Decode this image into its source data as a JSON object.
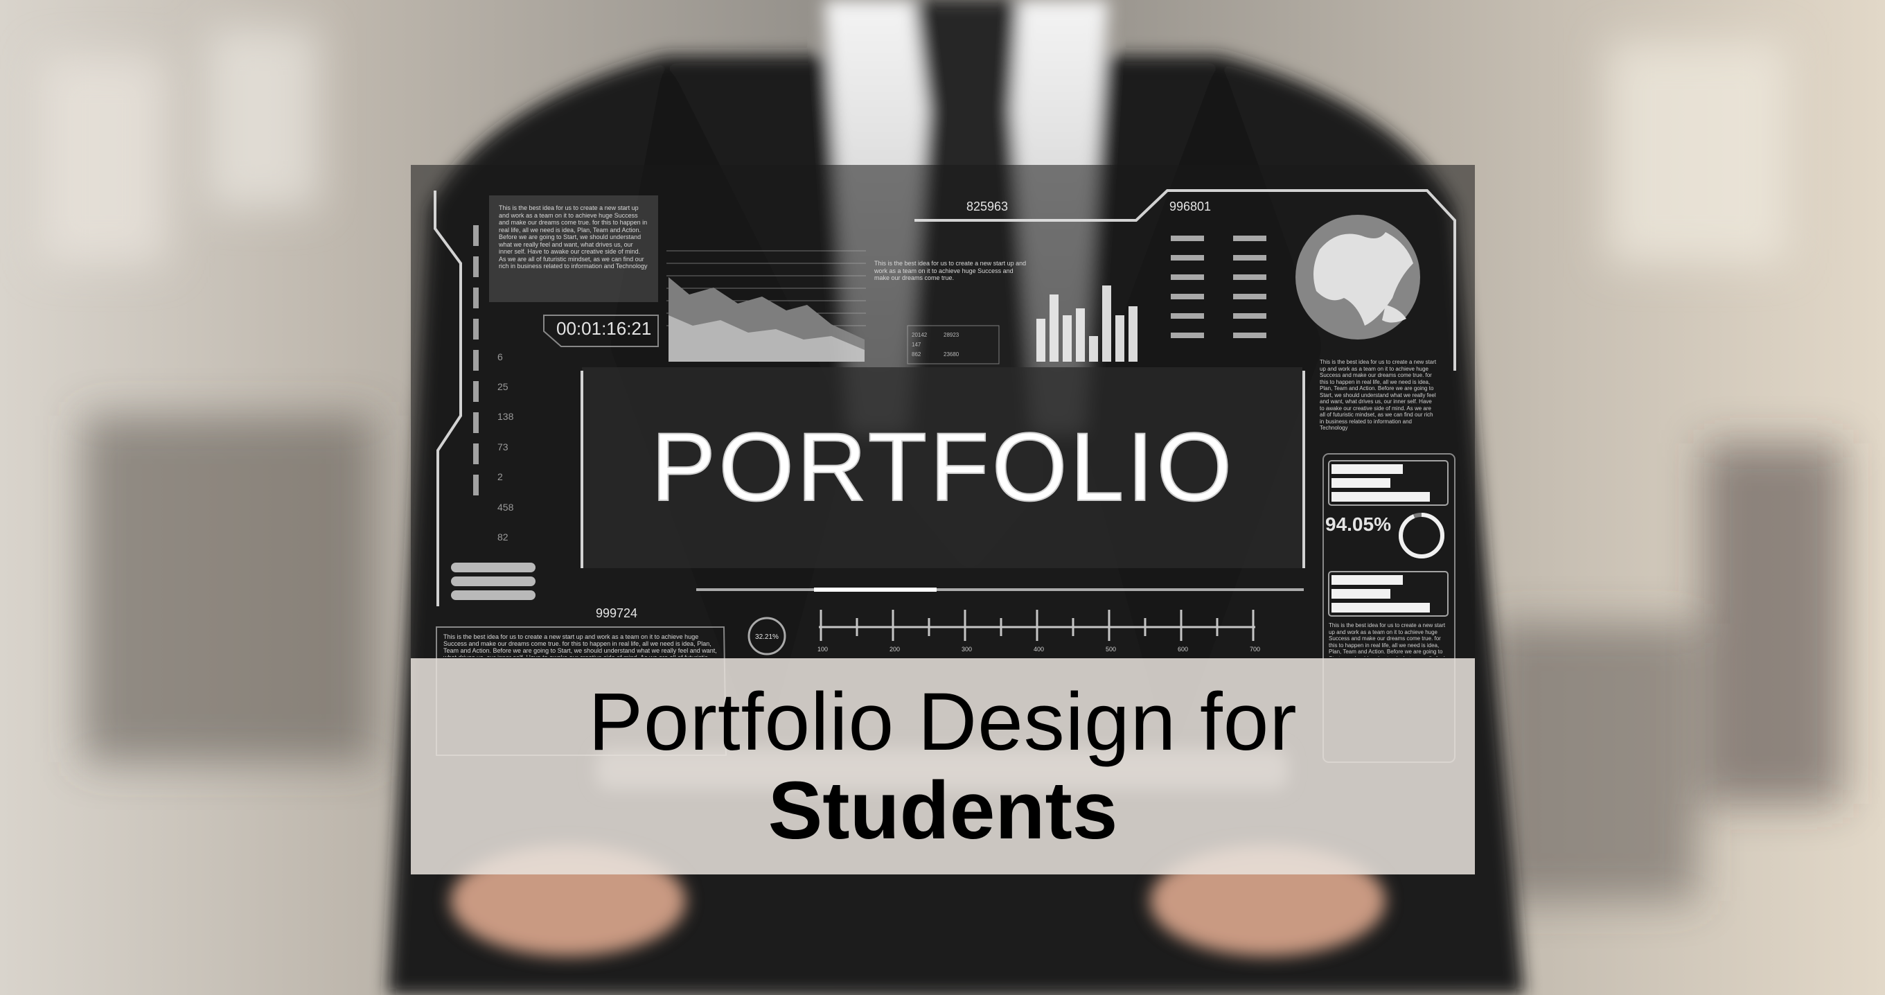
{
  "hero": {
    "headline": "PORTFOLIO",
    "timer": "00:01:16:21",
    "code_top": "825963",
    "code_right": "996801",
    "code_bottom": "999724",
    "percent_large": "94.05%",
    "percent_small": "32.21%",
    "percent_large_value": 0.9405,
    "percent_small_value": 0.3221,
    "scale_numbers": [
      "6",
      "25",
      "138",
      "73",
      "2",
      "458",
      "82"
    ],
    "ruler_ticks": [
      "100",
      "200",
      "300",
      "400",
      "500",
      "600",
      "700"
    ],
    "mini_table": [
      "20142",
      "28923",
      "147",
      "862",
      "23680"
    ],
    "paragraph_text": "This is the best idea for us to create a new start up and work as a team on it to achieve huge Success and make our dreams come true. for this to happen in real life, all we need is idea, Plan, Team and Action. Before we are going to Start, we should understand what we really feel and want, what drives us, our inner self. Have to awake our creative side of mind. As we are all of futuristic mindset, as we can find our rich in business related to information and Technology",
    "paragraph_text_short": "This is the best idea for us to create a new start up and work as a team on it to achieve huge Success and make our dreams come true."
  },
  "caption": {
    "line1": "Portfolio Design for",
    "line2": "Students"
  },
  "colors": {
    "hud_line": "#e8e8e8",
    "caption_bg": "#e8e2dc",
    "caption_text": "#000000"
  }
}
